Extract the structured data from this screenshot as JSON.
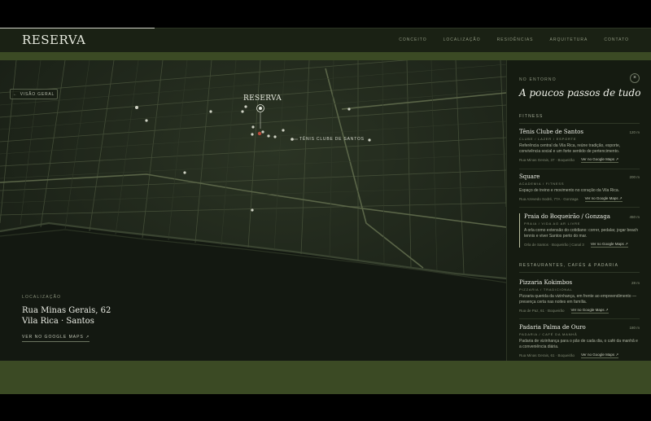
{
  "header": {
    "logo": "RESERVA",
    "nav": [
      "CONCEITO",
      "LOCALIZAÇÃO",
      "RESIDÊNCIAS",
      "ARQUITETURA",
      "CONTATO"
    ]
  },
  "map": {
    "back_label": "VISÃO GERAL",
    "logo": "RESERVA",
    "poi_label": "TÊNIS CLUBE DE SANTOS"
  },
  "location": {
    "kicker": "LOCALIZAÇÃO",
    "line1": "Rua Minas Gerais, 62",
    "line2": "Vila Rica · Santos",
    "link": "VER NO GOOGLE MAPS ↗"
  },
  "panel": {
    "kicker": "NO ENTORNO",
    "close": "×",
    "title": "A poucos passos de tudo",
    "sections": [
      {
        "title": "FITNESS",
        "items": [
          {
            "name": "Tênis Clube de Santos",
            "distance": "120 m",
            "category": "CLUBE / LAZER / ESPORTE",
            "description": "Referência central da Vila Rica, reúne tradição, esporte, convivência social e um forte sentido de pertencimento.",
            "address": "Rua Minas Gerais, 37 · Boqueirão",
            "maps": "Ver no Google Maps ↗"
          },
          {
            "name": "Square",
            "distance": "200 m",
            "category": "ACADEMIA / FITNESS",
            "description": "Espaço de treino e movimento no coração da Vila Rica.",
            "address": "Rua Azevedo Sodré, 77A · Gonzaga",
            "maps": "Ver no Google Maps ↗"
          },
          {
            "name": "Praia do Boqueirão / Gonzaga",
            "distance": "450 m",
            "category": "PRAIA / VIDA AO AR LIVRE",
            "description": "A orla como extensão do cotidiano: correr, pedalar, jogar beach tennis e viver Santos perto do mar.",
            "address": "Orla de Santos · Boqueirão | Canal 3",
            "maps": "Ver no Google Maps ↗"
          }
        ]
      },
      {
        "title": "RESTAURANTES, CAFÉS & PADARIA",
        "items": [
          {
            "name": "Pizzaria Kokimbos",
            "distance": "28 m",
            "category": "PIZZARIA / TRADICIONAL",
            "description": "Pizzaria querida da vizinhança, em frente ao empreendimento — presença certa nas noites em família.",
            "address": "Rua de Paz, 61 · Boqueirão",
            "maps": "Ver no Google Maps ↗"
          },
          {
            "name": "Padaria Palma de Ouro",
            "distance": "180 m",
            "category": "PADARIA / CAFÉ DA MANHÃ",
            "description": "Padaria de vizinhança para o pão de cada dia, o café da manhã e a conveniência diária.",
            "address": "Rua Minas Gerais, 61 · Boqueirão",
            "maps": "Ver no Google Maps ↗"
          }
        ]
      }
    ]
  }
}
